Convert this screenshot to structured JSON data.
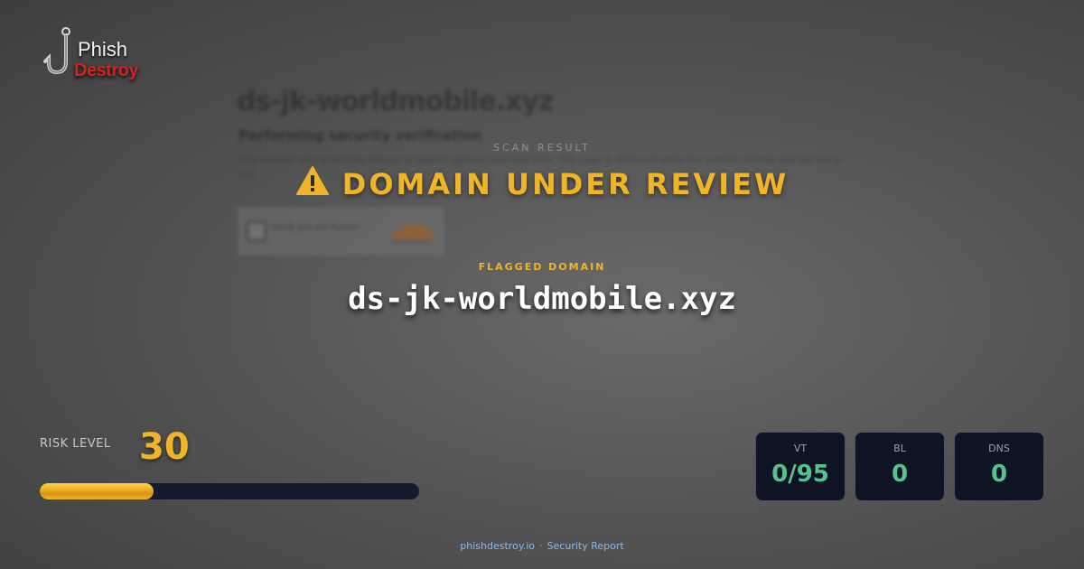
{
  "logo": {
    "line1": "Phish",
    "line2": "Destroy"
  },
  "backdrop": {
    "title": "ds-jk-worldmobile.xyz",
    "subtitle": "Performing security verification",
    "body": "This website uses a security service to protect against malicious bots. This page is displayed while the website verifies you are not a bot.",
    "checkbox_label": "Verify you are human"
  },
  "scan": {
    "label": "SCAN RESULT",
    "status": "DOMAIN UNDER REVIEW",
    "status_icon": "warning-icon"
  },
  "flagged": {
    "label": "FLAGGED DOMAIN",
    "domain": "ds-jk-worldmobile.xyz"
  },
  "risk": {
    "label": "RISK LEVEL",
    "value": "30",
    "fraction": 0.3
  },
  "stats": [
    {
      "label": "VT",
      "value": "0/95"
    },
    {
      "label": "BL",
      "value": "0"
    },
    {
      "label": "DNS",
      "value": "0"
    }
  ],
  "footer": {
    "site": "phishdestroy.io",
    "separator": "·",
    "label": "Security Report"
  },
  "colors": {
    "accent": "#f0b429",
    "stat_value": "#56c28e",
    "card_bg": "#0e1423",
    "logo_red": "#d42020",
    "footer_link": "#88b8e6"
  }
}
